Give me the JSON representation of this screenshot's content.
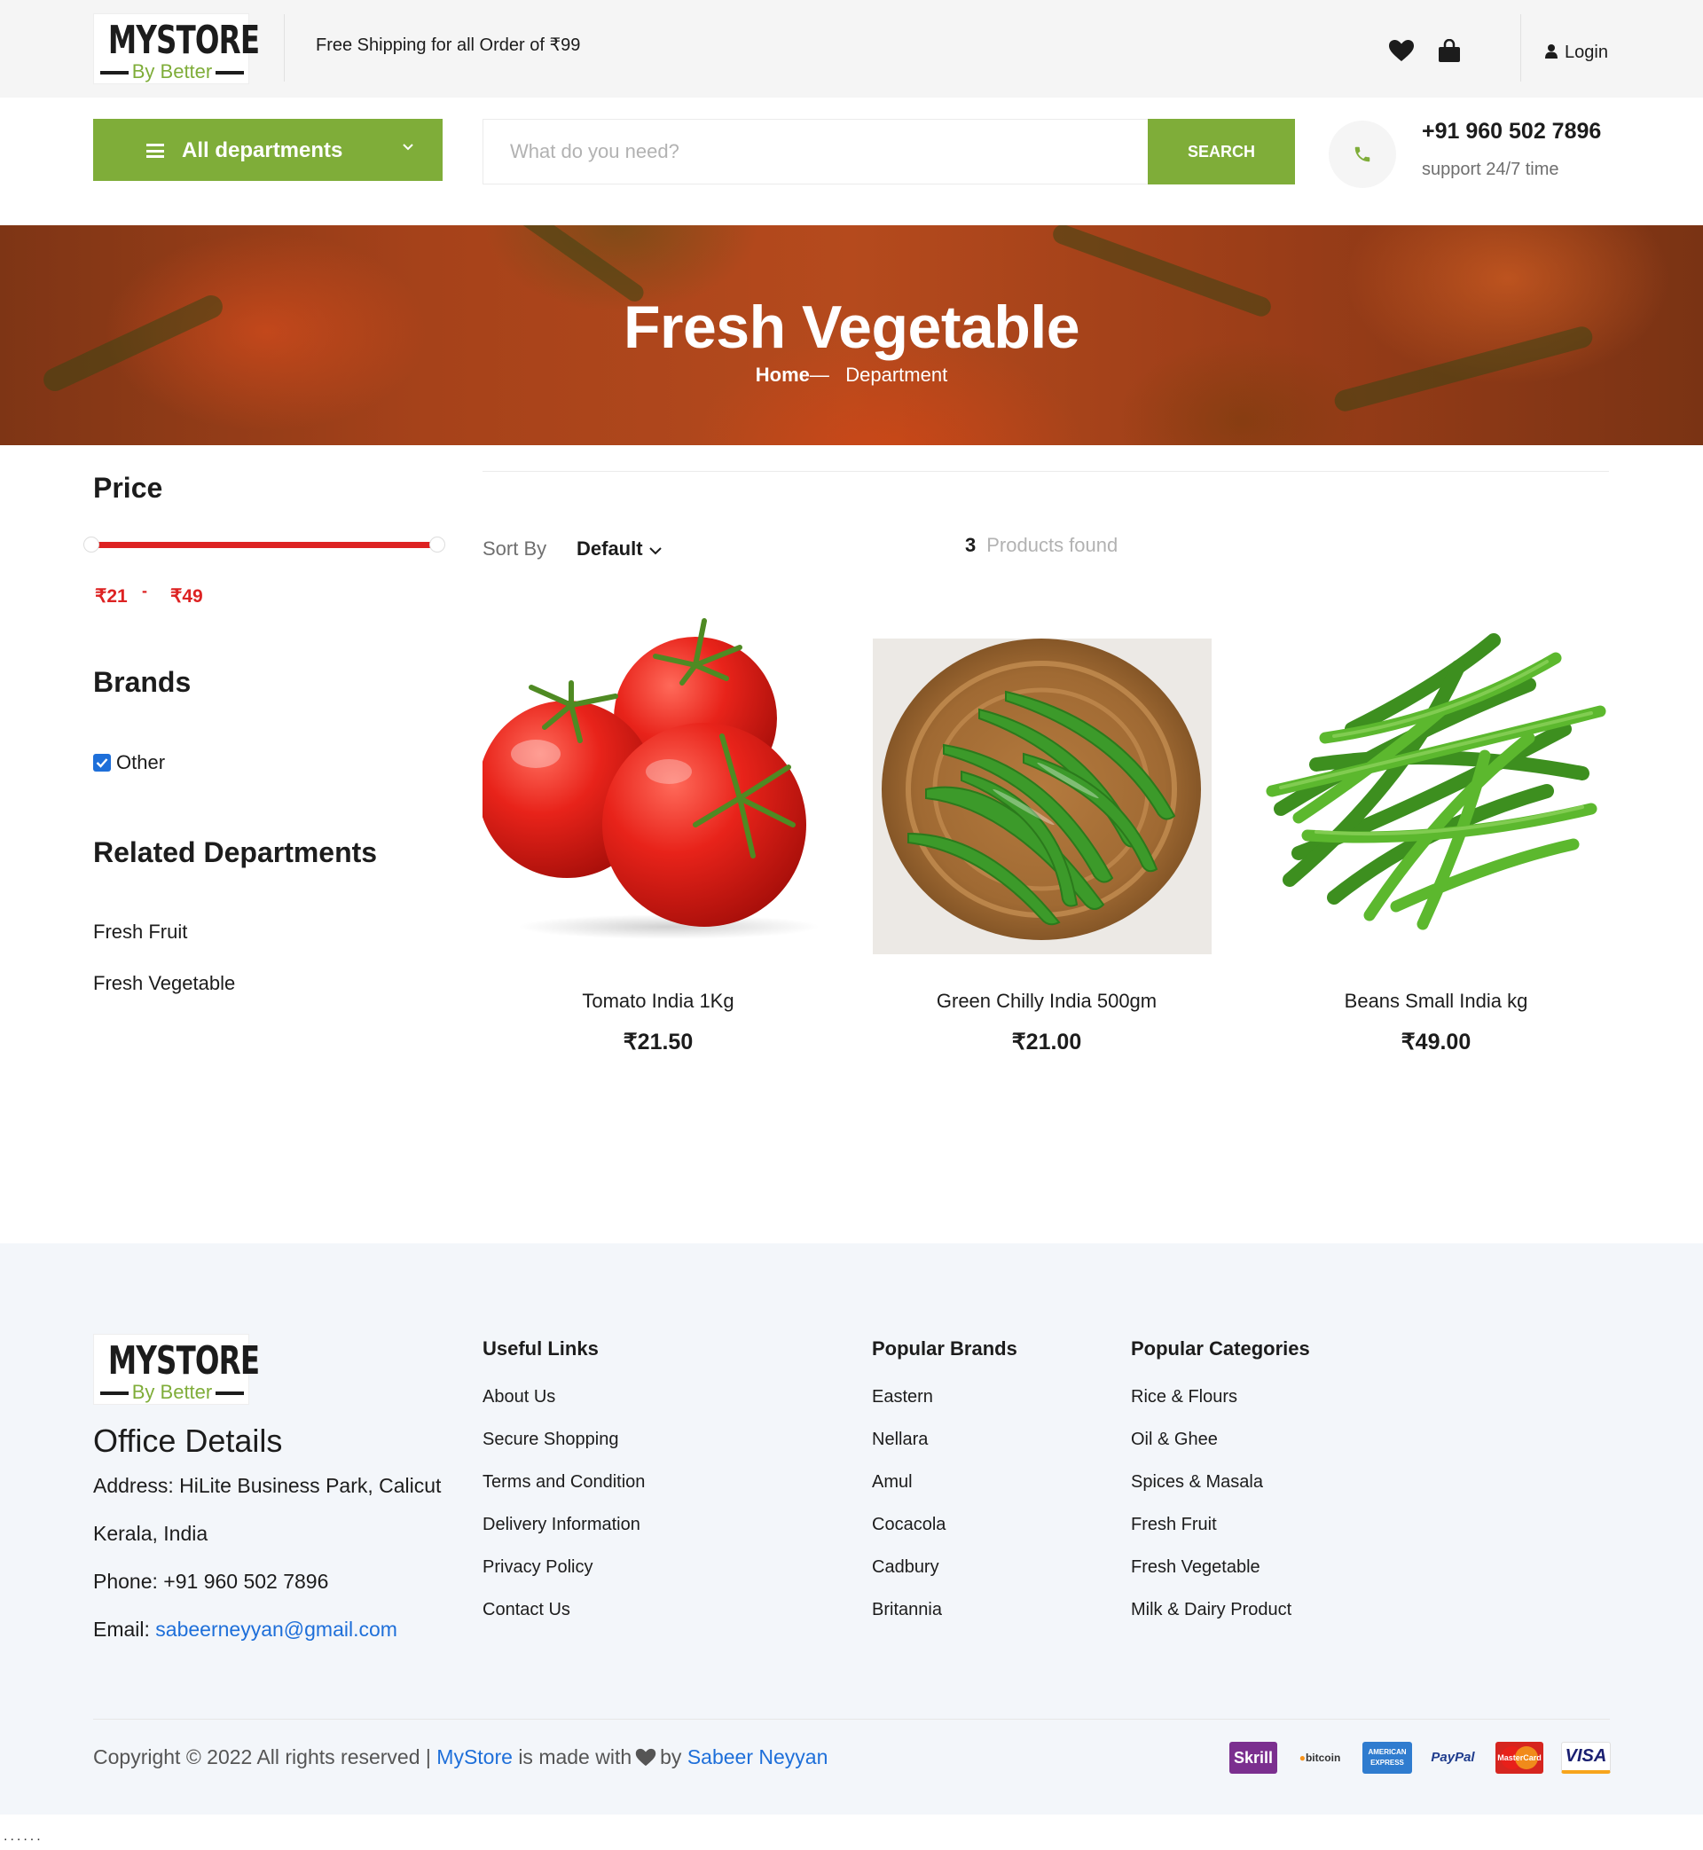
{
  "brand": {
    "logo_main": "MYSTORE",
    "logo_sub": "By Better"
  },
  "topbar": {
    "shipping_text": "Free Shipping for all Order of ₹99",
    "login_label": "Login"
  },
  "header": {
    "departments_label": "All departments",
    "search_placeholder": "What do you need?",
    "search_button": "SEARCH",
    "phone": "+91 960 502 7896",
    "support_text": "support 24/7 time"
  },
  "hero": {
    "title": "Fresh Vegetable",
    "breadcrumb_home": "Home",
    "breadcrumb_sep": "—",
    "breadcrumb_current": "Department"
  },
  "sidebar": {
    "price_title": "Price",
    "price_min": "₹21",
    "price_sep": "-",
    "price_max": "₹49",
    "price_range_fill": {
      "from": 0.0,
      "to": 1.0
    },
    "brands_title": "Brands",
    "brands": [
      {
        "label": "Other",
        "checked": true
      }
    ],
    "related_title": "Related Departments",
    "related": [
      "Fresh Fruit",
      "Fresh Vegetable"
    ]
  },
  "listing": {
    "sort_label": "Sort By",
    "sort_value": "Default",
    "found_count": "3",
    "found_label": "Products found",
    "products": [
      {
        "name": "Tomato India 1Kg",
        "price": "₹21.50",
        "image": "tomato"
      },
      {
        "name": "Green Chilly India 500gm",
        "price": "₹21.00",
        "image": "green-chilly-basket"
      },
      {
        "name": "Beans Small India kg",
        "price": "₹49.00",
        "image": "green-beans"
      }
    ]
  },
  "footer": {
    "office_title": "Office Details",
    "address_line1": "Address: HiLite Business Park, Calicut",
    "address_line2": "Kerala, India",
    "phone_line": "Phone: +91 960 502 7896",
    "email_label": "Email:",
    "email": "sabeerneyyan@gmail.com",
    "useful_links_title": "Useful Links",
    "useful_links": [
      "About Us",
      "Secure Shopping",
      "Terms and Condition",
      "Delivery Information",
      "Privacy Policy",
      "Contact Us"
    ],
    "brands_title": "Popular Brands",
    "brands": [
      "Eastern",
      "Nellara",
      "Amul",
      "Cocacola",
      "Cadbury",
      "Britannia"
    ],
    "categories_title": "Popular Categories",
    "categories": [
      "Rice & Flours",
      "Oil & Ghee",
      "Spices & Masala",
      "Fresh Fruit",
      "Fresh Vegetable",
      "Milk & Dairy Product"
    ],
    "copyright_prefix": "Copyright © 2022 All rights reserved |",
    "copyright_store": "MyStore",
    "copyright_mid": "is made with",
    "copyright_by": "by",
    "copyright_author": "Sabeer Neyyan",
    "payments": [
      "Skrill",
      "bitcoin",
      "AMERICAN EXPRESS",
      "PayPal",
      "MasterCard",
      "VISA"
    ]
  },
  "colors": {
    "accent": "#7fad39",
    "price_red": "#dd2222",
    "link_blue": "#1e6fd9",
    "footer_bg": "#f3f6fa",
    "topbar_bg": "#f5f5f5"
  },
  "trailing_text": "......"
}
